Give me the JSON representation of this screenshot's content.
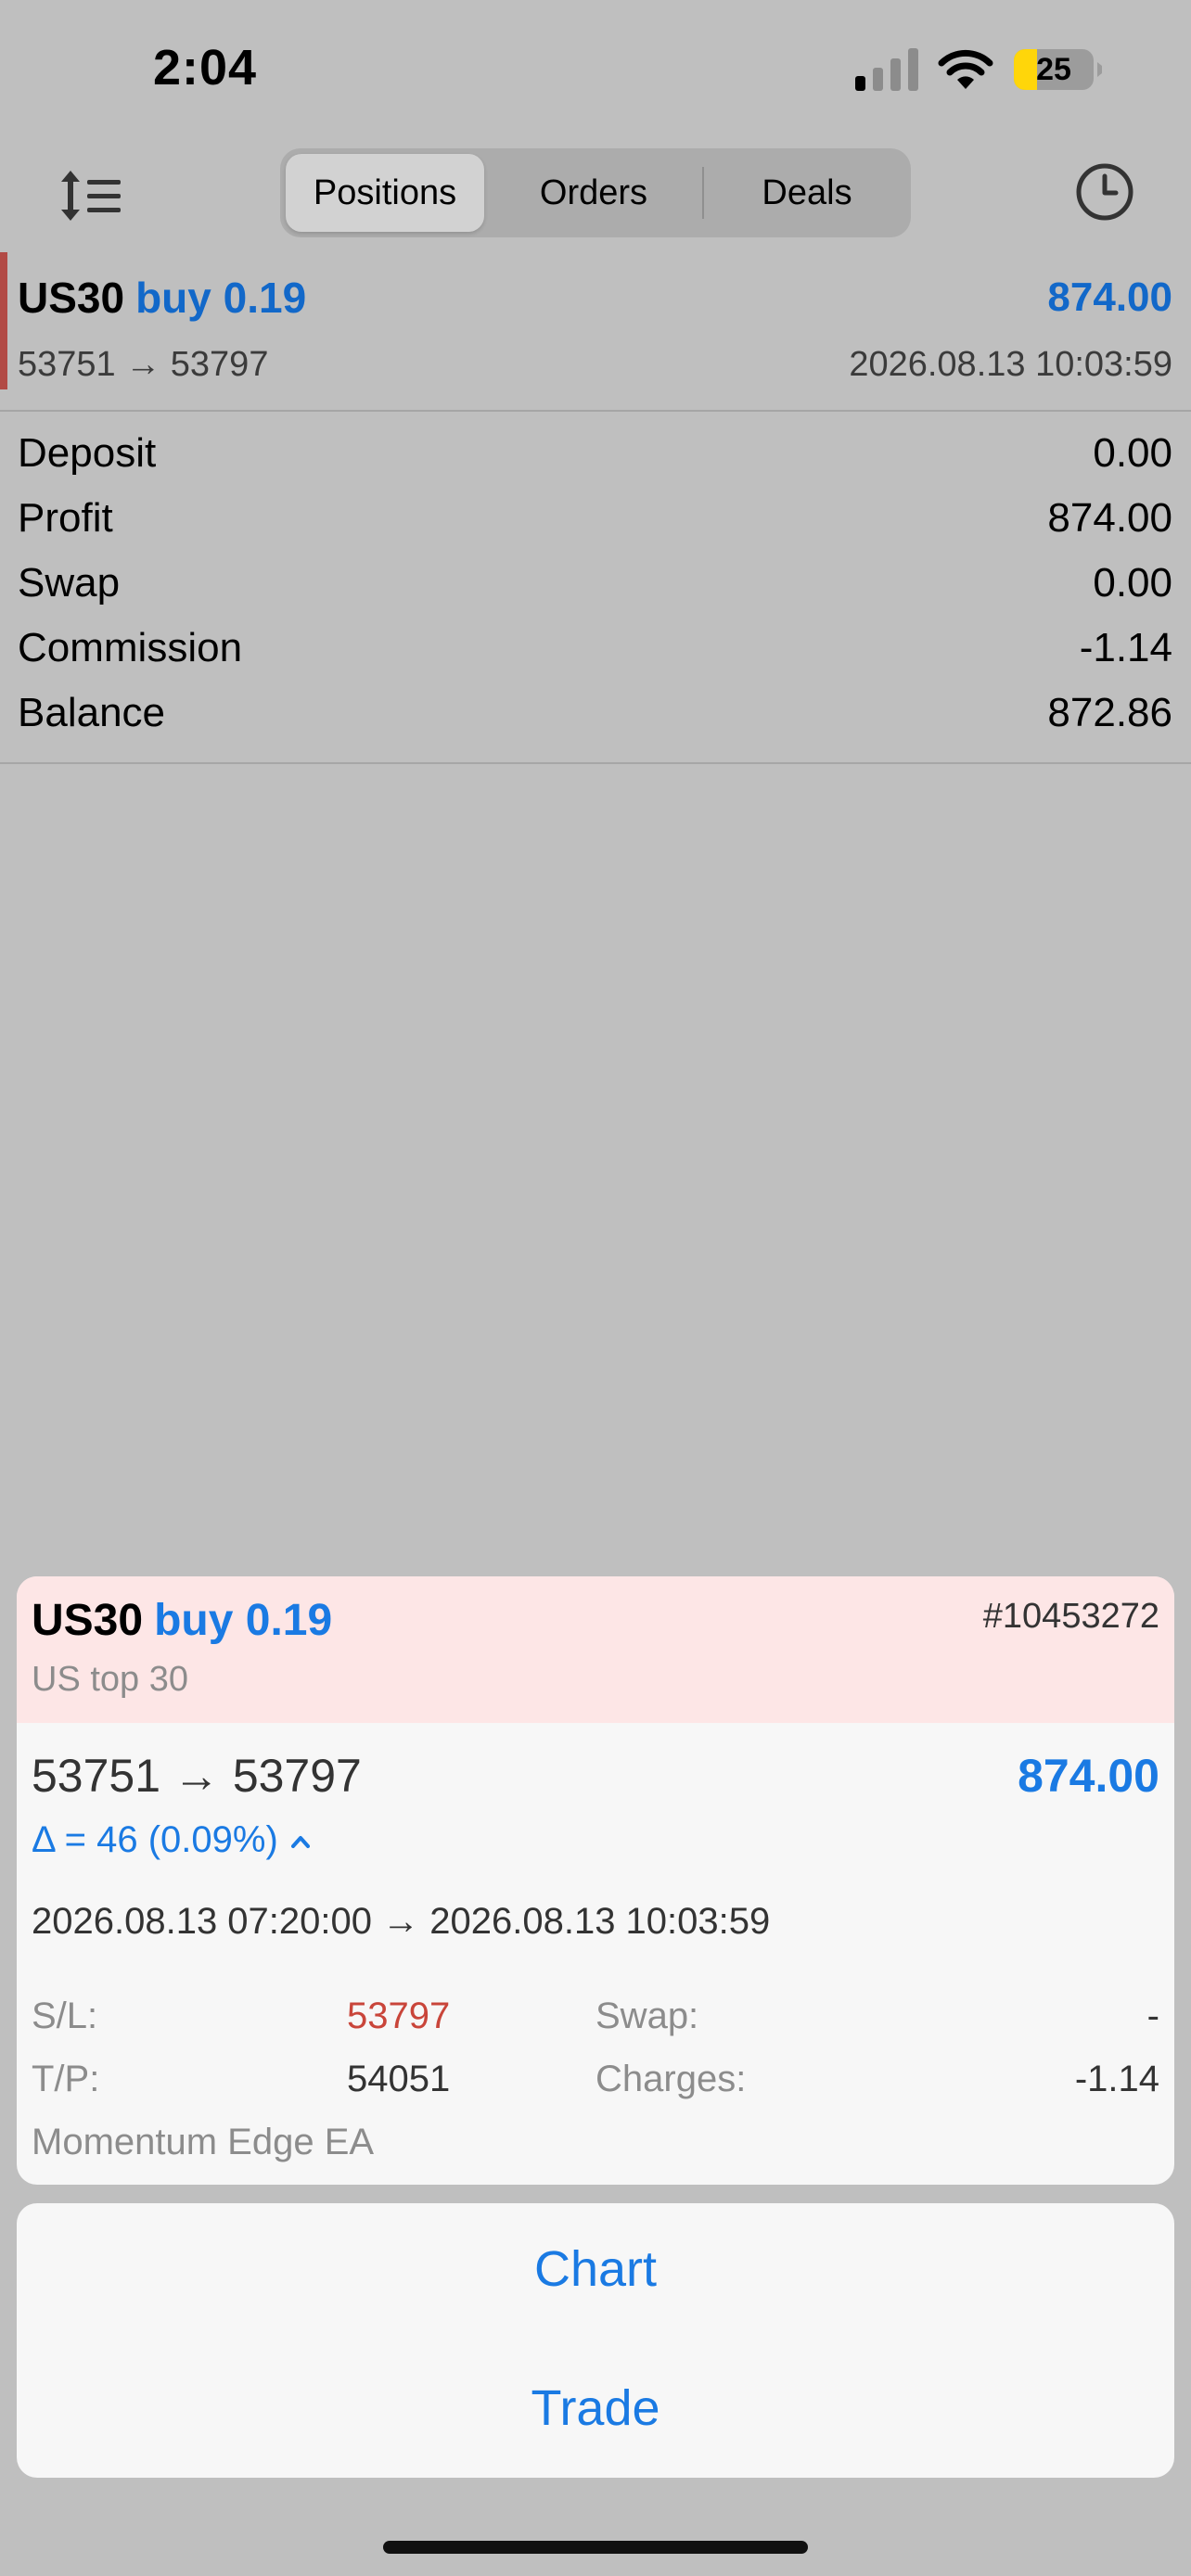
{
  "status_bar": {
    "time": "2:04",
    "battery": "25"
  },
  "toolbar": {
    "tabs": [
      {
        "label": "Positions",
        "active": true
      },
      {
        "label": "Orders",
        "active": false
      },
      {
        "label": "Deals",
        "active": false
      }
    ],
    "icons": {
      "sort": "sort-icon",
      "history": "clock-icon"
    }
  },
  "position": {
    "symbol": "US30",
    "side": "buy 0.19",
    "profit": "874.00",
    "prices": "53751 → 53797",
    "time": "2026.08.13 10:03:59"
  },
  "summary": [
    {
      "label": "Deposit",
      "value": "0.00"
    },
    {
      "label": "Profit",
      "value": "874.00"
    },
    {
      "label": "Swap",
      "value": "0.00"
    },
    {
      "label": "Commission",
      "value": "-1.14"
    },
    {
      "label": "Balance",
      "value": "872.86"
    }
  ],
  "detail": {
    "symbol": "US30",
    "side": "buy 0.19",
    "ticket": "#10453272",
    "description": "US top 30",
    "prices": "53751 → 53797",
    "profit": "874.00",
    "delta": "Δ = 46 (0.09%)",
    "times": "2026.08.13 07:20:00 → 2026.08.13 10:03:59",
    "sl_label": "S/L:",
    "sl_value": "53797",
    "tp_label": "T/P:",
    "tp_value": "54051",
    "swap_label": "Swap:",
    "swap_value": "-",
    "charges_label": "Charges:",
    "charges_value": "-1.14",
    "comment": "Momentum Edge EA"
  },
  "actions": {
    "chart": "Chart",
    "trade": "Trade"
  },
  "colors": {
    "accent_blue": "#1a7ae3",
    "row_blue": "#1268c9",
    "loss_red": "#c9453a",
    "header_pink": "#fde6e6",
    "battery_yellow": "#ffd60a"
  }
}
